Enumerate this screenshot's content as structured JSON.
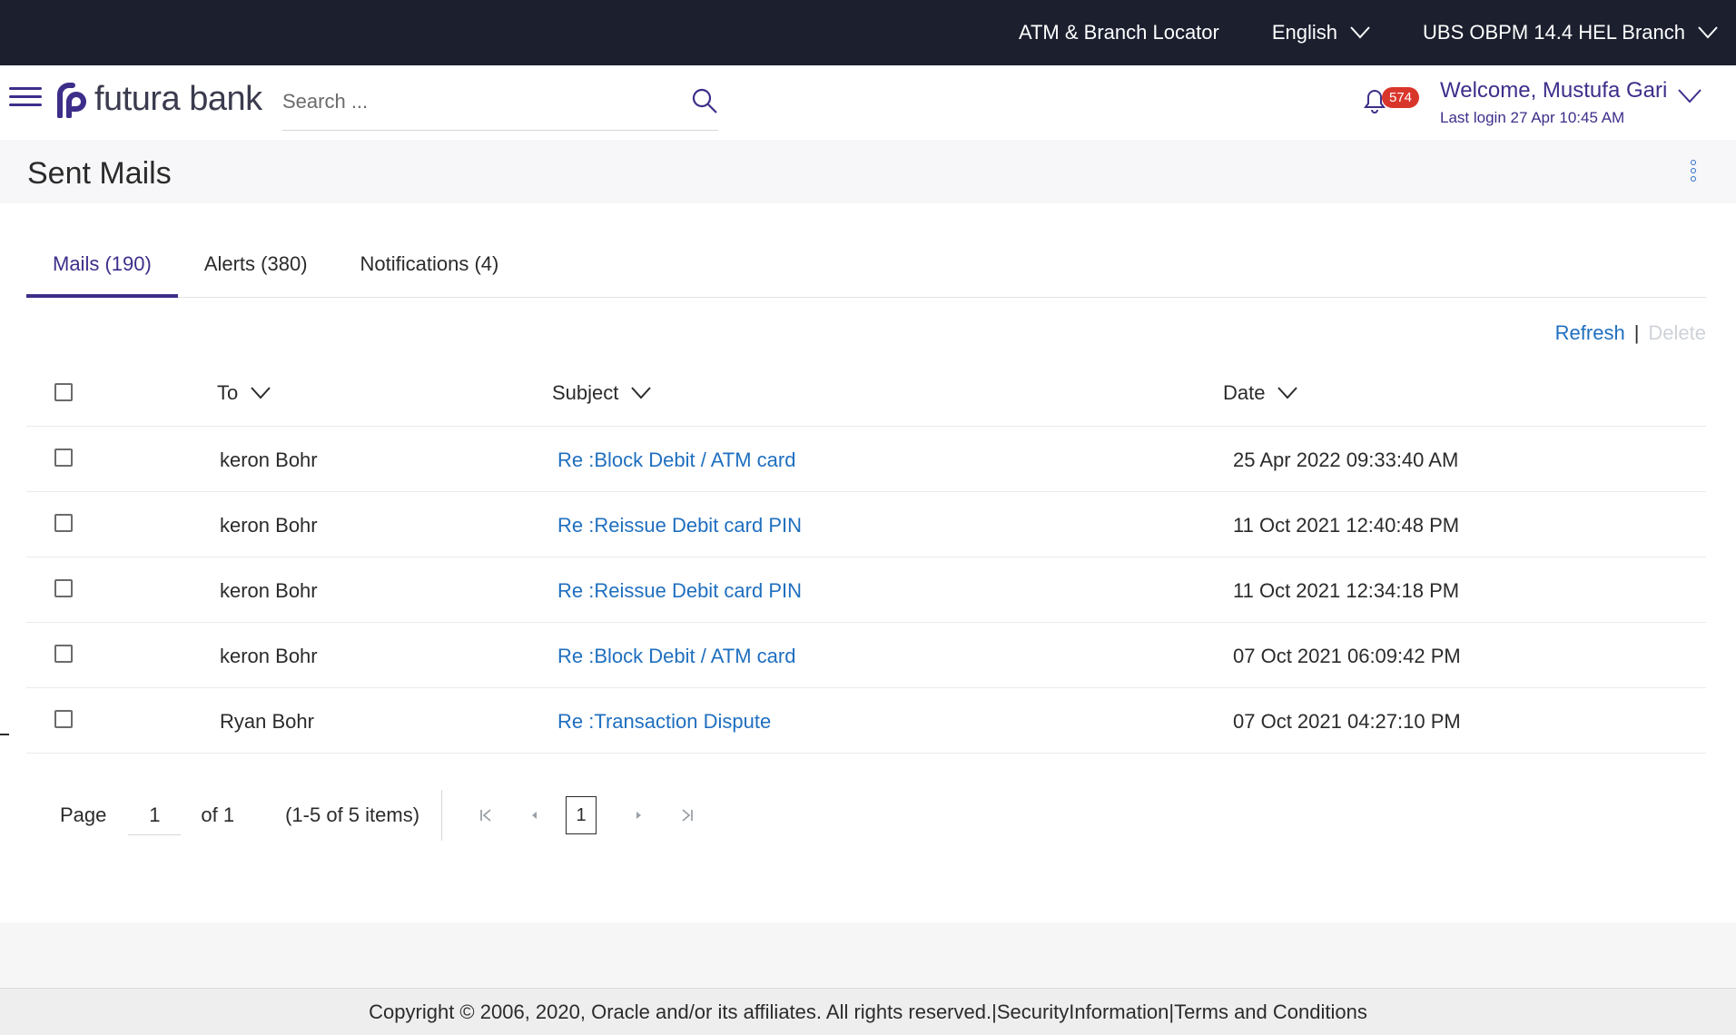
{
  "topbar": {
    "locator": "ATM & Branch Locator",
    "language": "English",
    "branch": "UBS OBPM 14.4 HEL Branch"
  },
  "header": {
    "brand": "futura bank",
    "search_placeholder": "Search ...",
    "notifications_count": "574",
    "welcome": "Welcome, Mustufa Gari",
    "last_login": "Last login 27 Apr 10:45 AM"
  },
  "page": {
    "title": "Sent Mails"
  },
  "tabs": [
    {
      "label": "Mails (190)",
      "active": true
    },
    {
      "label": "Alerts (380)",
      "active": false
    },
    {
      "label": "Notifications (4)",
      "active": false
    }
  ],
  "actions": {
    "refresh": "Refresh",
    "separator": "|",
    "delete": "Delete"
  },
  "table": {
    "columns": {
      "to": "To",
      "subject": "Subject",
      "date": "Date"
    },
    "rows": [
      {
        "to": "keron Bohr",
        "subject": "Re :Block Debit / ATM card",
        "date": "25 Apr 2022 09:33:40 AM"
      },
      {
        "to": "keron Bohr",
        "subject": "Re :Reissue Debit card PIN",
        "date": "11 Oct 2021 12:40:48 PM"
      },
      {
        "to": "keron Bohr",
        "subject": "Re :Reissue Debit card PIN",
        "date": "11 Oct 2021 12:34:18 PM"
      },
      {
        "to": "keron Bohr",
        "subject": "Re :Block Debit / ATM card",
        "date": "07 Oct 2021 06:09:42 PM"
      },
      {
        "to": "Ryan Bohr",
        "subject": "Re :Transaction Dispute",
        "date": "07 Oct 2021 04:27:10 PM"
      }
    ]
  },
  "pagination": {
    "page_label": "Page",
    "current_page": "1",
    "of_label": "of 1",
    "items_label": "(1-5 of 5 items)",
    "page_button": "1"
  },
  "footer": {
    "copyright": "Copyright © 2006, 2020, Oracle and/or its affiliates. All rights reserved.",
    "sep1": "|",
    "security": "SecurityInformation",
    "sep2": "|",
    "terms": "Terms and Conditions"
  },
  "colors": {
    "topbar_bg": "#1b1f2e",
    "brand_purple": "#3d2e8a",
    "link_blue": "#1f6fbf",
    "badge_red": "#d9362b"
  }
}
